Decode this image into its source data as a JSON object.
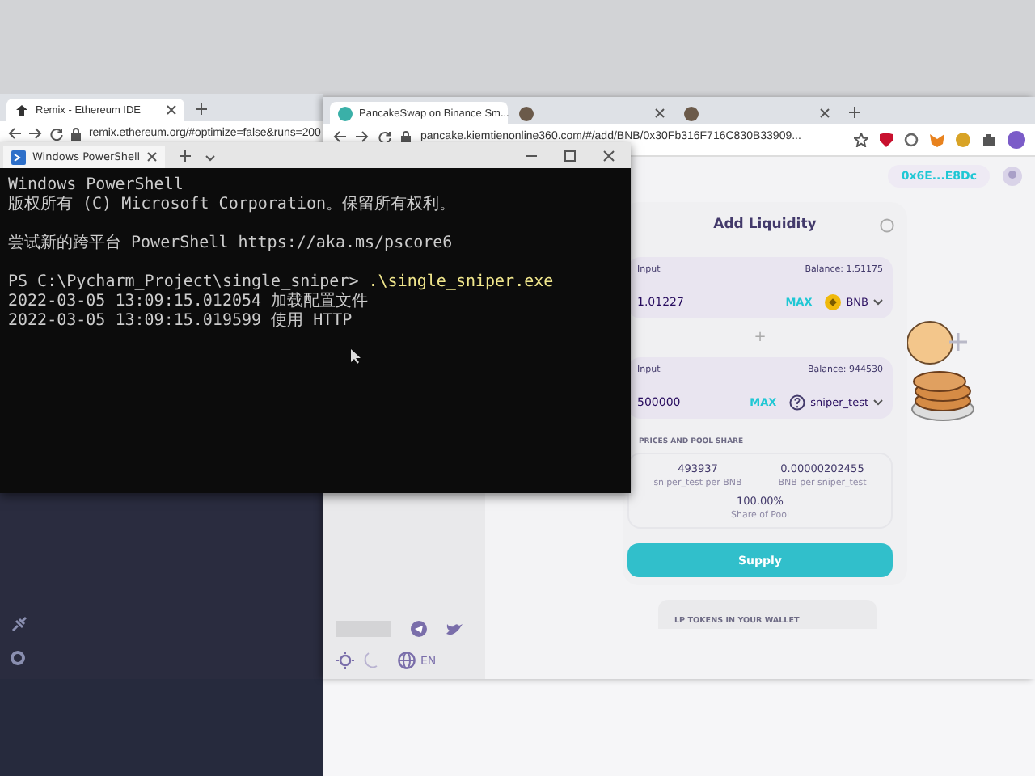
{
  "remix": {
    "tab": "Remix - Ethereum IDE",
    "url": "remix.ethereum.org/#optimize=false&runs=200"
  },
  "browser": {
    "tabs": [
      {
        "title": "PancakeSwap on Binance Sm...",
        "selected": true
      }
    ],
    "url": "pancake.kiemtienonline360.com/#/add/BNB/0x30Fb316F716C830B33909...",
    "wallet": "0x6E...E8Dc"
  },
  "terminal": {
    "title": "Windows PowerShell",
    "lines": [
      {
        "kind": "text",
        "text": "Windows PowerShell"
      },
      {
        "kind": "text",
        "text": "版权所有 (C) Microsoft Corporation。保留所有权利。"
      },
      {
        "kind": "gap"
      },
      {
        "kind": "text",
        "text": "尝试新的跨平台 PowerShell https://aka.ms/pscore6"
      },
      {
        "kind": "gap"
      },
      {
        "kind": "prompt",
        "text": "PS C:\\Pycharm_Project\\single_sniper>",
        "command": ".\\single_sniper.exe"
      },
      {
        "kind": "text",
        "text": "2022-03-05 13:09:15.012054 加载配置文件"
      },
      {
        "kind": "text",
        "text": "2022-03-05 13:09:15.019599 使用 HTTP"
      }
    ]
  },
  "liquidity": {
    "title": "Add Liquidity",
    "inputs": [
      {
        "label": "Input",
        "balance": "Balance: 1.51175",
        "amount": "1.01227",
        "max": "MAX",
        "token": "BNB",
        "kind": "bnb"
      },
      {
        "label": "Input",
        "balance": "Balance: 944530",
        "amount": "500000",
        "max": "MAX",
        "token": "sniper_test",
        "kind": "unknown"
      }
    ],
    "plus": "+",
    "prices_heading": "PRICES AND POOL SHARE",
    "prices": [
      {
        "value": "493937",
        "label": "sniper_test per BNB"
      },
      {
        "value": "0.00000202455",
        "label": "BNB per sniper_test"
      },
      {
        "value": "100.00%",
        "label": "Share of Pool"
      }
    ],
    "supply": "Supply",
    "lp_heading": "LP TOKENS IN YOUR WALLET"
  },
  "footer": {
    "language": "EN"
  }
}
